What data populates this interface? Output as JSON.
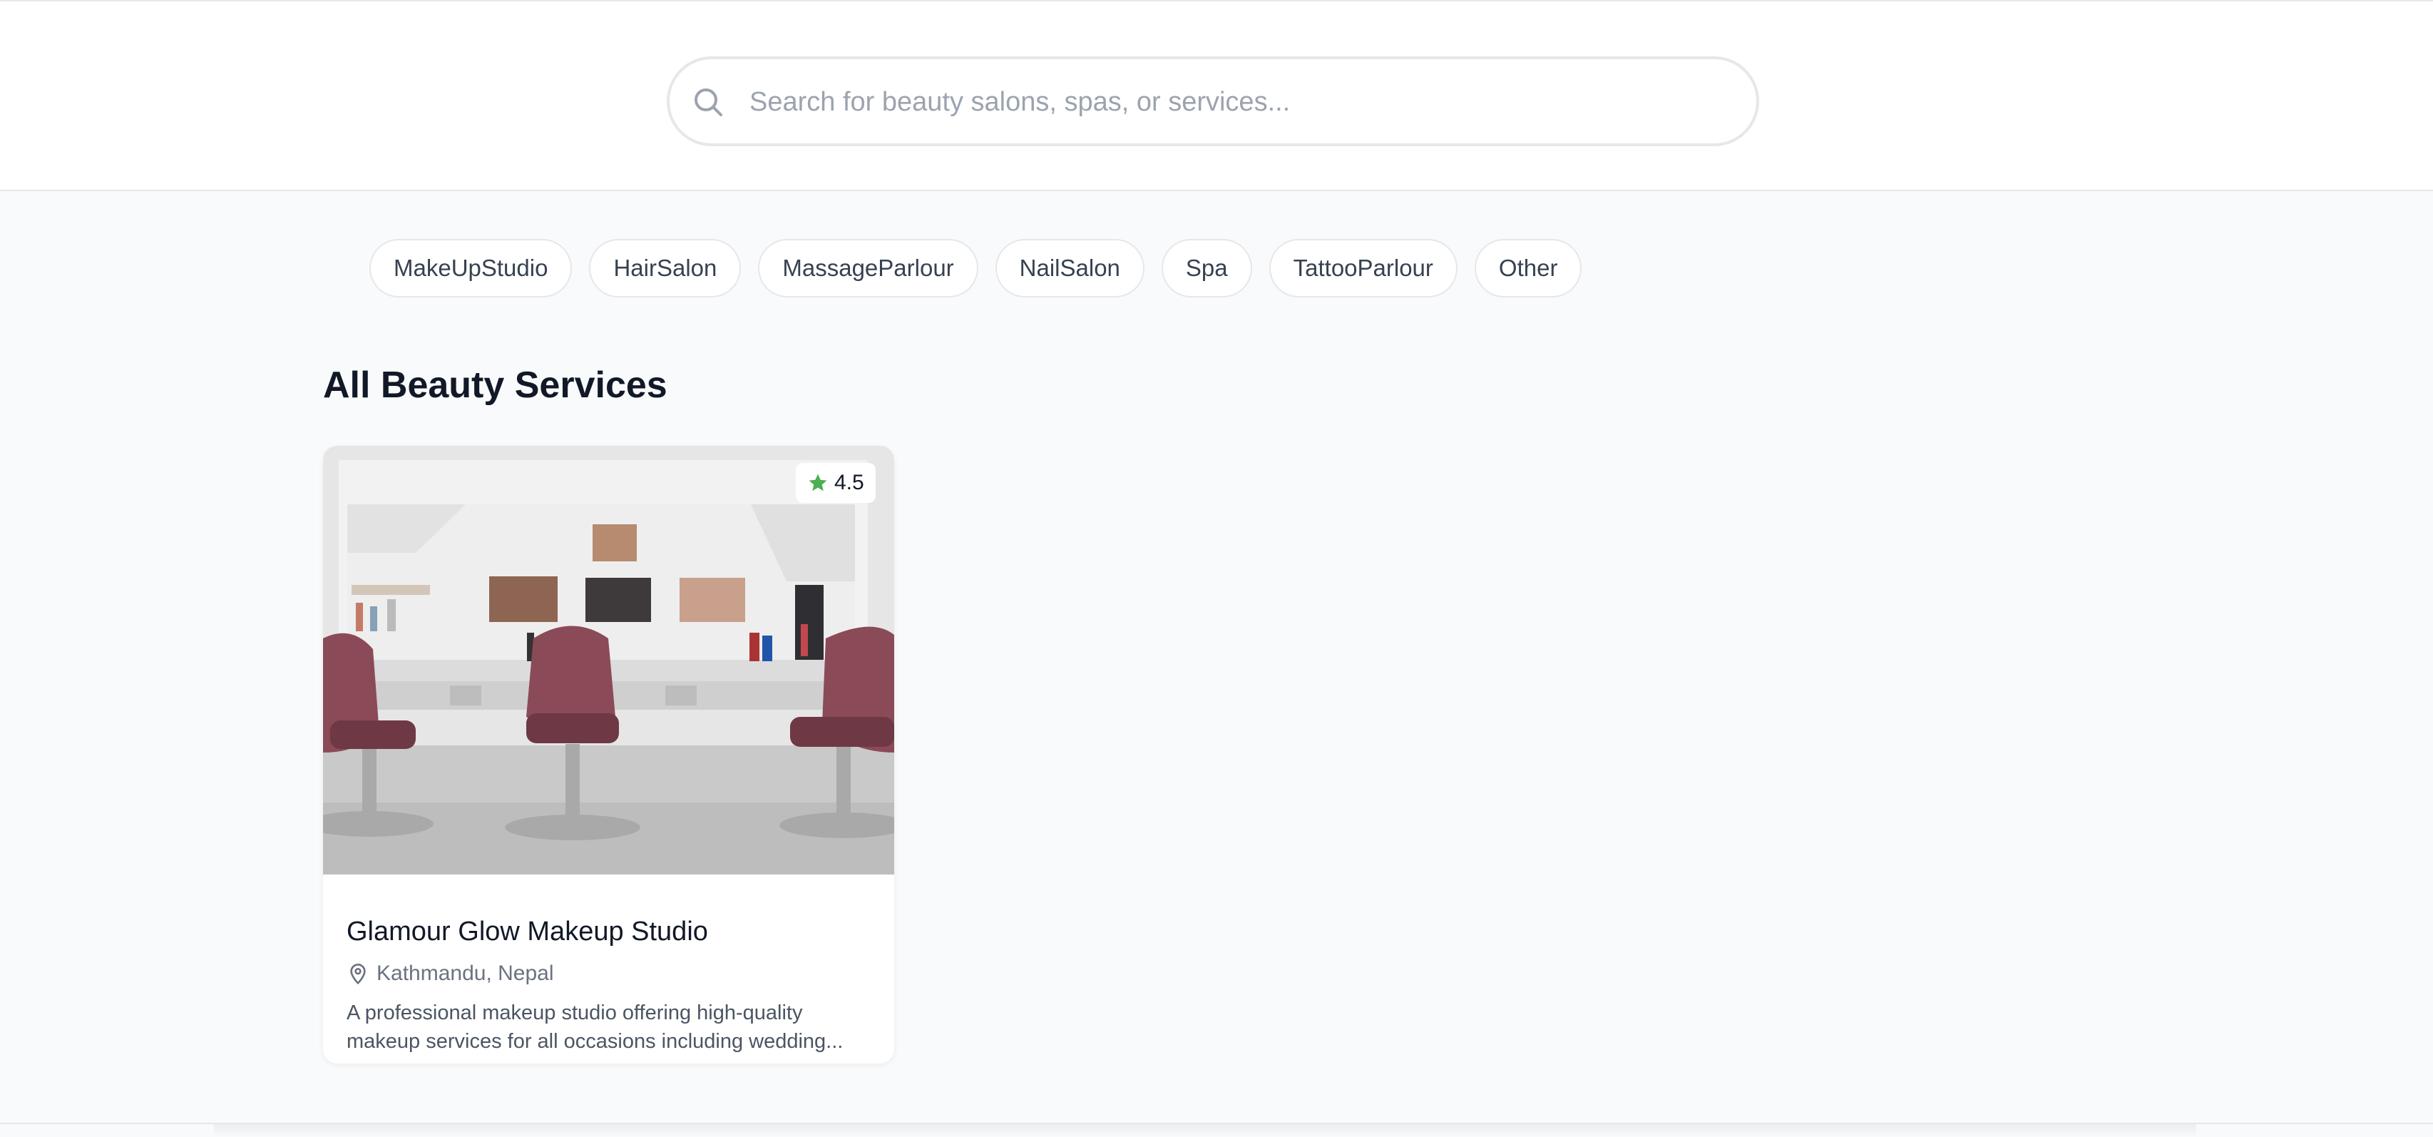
{
  "search": {
    "placeholder": "Search for beauty salons, spas, or services..."
  },
  "categories": [
    "MakeUpStudio",
    "HairSalon",
    "MassageParlour",
    "NailSalon",
    "Spa",
    "TattooParlour",
    "Other"
  ],
  "section": {
    "title": "All Beauty Services"
  },
  "card": {
    "rating": "4.5",
    "name": "Glamour Glow Makeup Studio",
    "location": "Kathmandu, Nepal",
    "description_line1": "A professional makeup studio offering high-quality",
    "description_line2": "makeup services for all occasions including wedding..."
  },
  "colors": {
    "page_bg": "#f9fafb",
    "rating_star": "#4caf50",
    "chair_color": "#8b4a57",
    "text_primary": "#111827",
    "text_muted": "#6b7280"
  },
  "icons": {
    "search": "search-icon",
    "star": "star-icon",
    "location": "map-pin-icon"
  }
}
